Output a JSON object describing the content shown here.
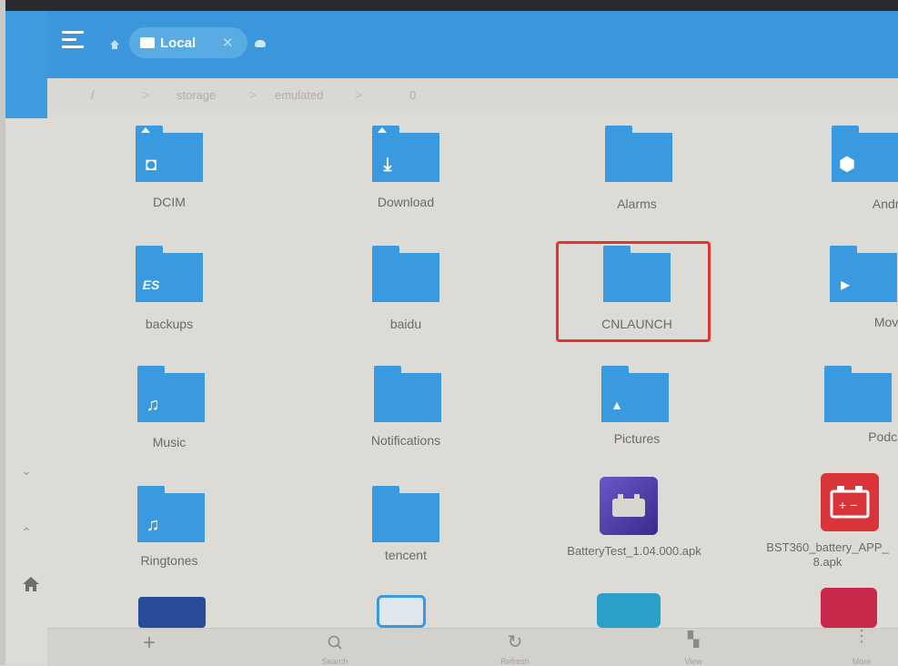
{
  "toolbar": {
    "location_chip": "Local",
    "close_glyph": "✕"
  },
  "path": {
    "root": "/",
    "segments": [
      "storage",
      "emulated",
      "0"
    ],
    "separator": ">"
  },
  "items": [
    {
      "name": "DCIM",
      "type": "folder",
      "glyph": "camera"
    },
    {
      "name": "Download",
      "type": "folder",
      "glyph": "download"
    },
    {
      "name": "Alarms",
      "type": "folder",
      "glyph": ""
    },
    {
      "name": "Android",
      "type": "folder",
      "glyph": "gear"
    },
    {
      "name": "backups",
      "type": "folder",
      "glyph": "es"
    },
    {
      "name": "baidu",
      "type": "folder",
      "glyph": ""
    },
    {
      "name": "CNLAUNCH",
      "type": "folder",
      "glyph": ""
    },
    {
      "name": "Movies",
      "type": "folder",
      "glyph": "play"
    },
    {
      "name": "Music",
      "type": "folder",
      "glyph": "note"
    },
    {
      "name": "Notifications",
      "type": "folder",
      "glyph": ""
    },
    {
      "name": "Pictures",
      "type": "folder",
      "glyph": "image"
    },
    {
      "name": "Podcasts",
      "type": "folder",
      "glyph": ""
    },
    {
      "name": "Ringtones",
      "type": "folder",
      "glyph": "note"
    },
    {
      "name": "tencent",
      "type": "folder",
      "glyph": ""
    },
    {
      "name": "BatteryTest_1.04.000.apk",
      "type": "apk",
      "glyph": "battery-test"
    },
    {
      "name": "BST360_battery_APP_\n8.apk",
      "type": "apk",
      "glyph": "battery-red"
    }
  ],
  "bottom": {
    "add_glyph": "+",
    "search_label": "Search",
    "refresh_label": "Refresh",
    "view_label": "View",
    "more_label": "More"
  },
  "colors": {
    "accent": "#3b96dc",
    "folder": "#3a9ae0",
    "highlight": "#e0342c"
  }
}
